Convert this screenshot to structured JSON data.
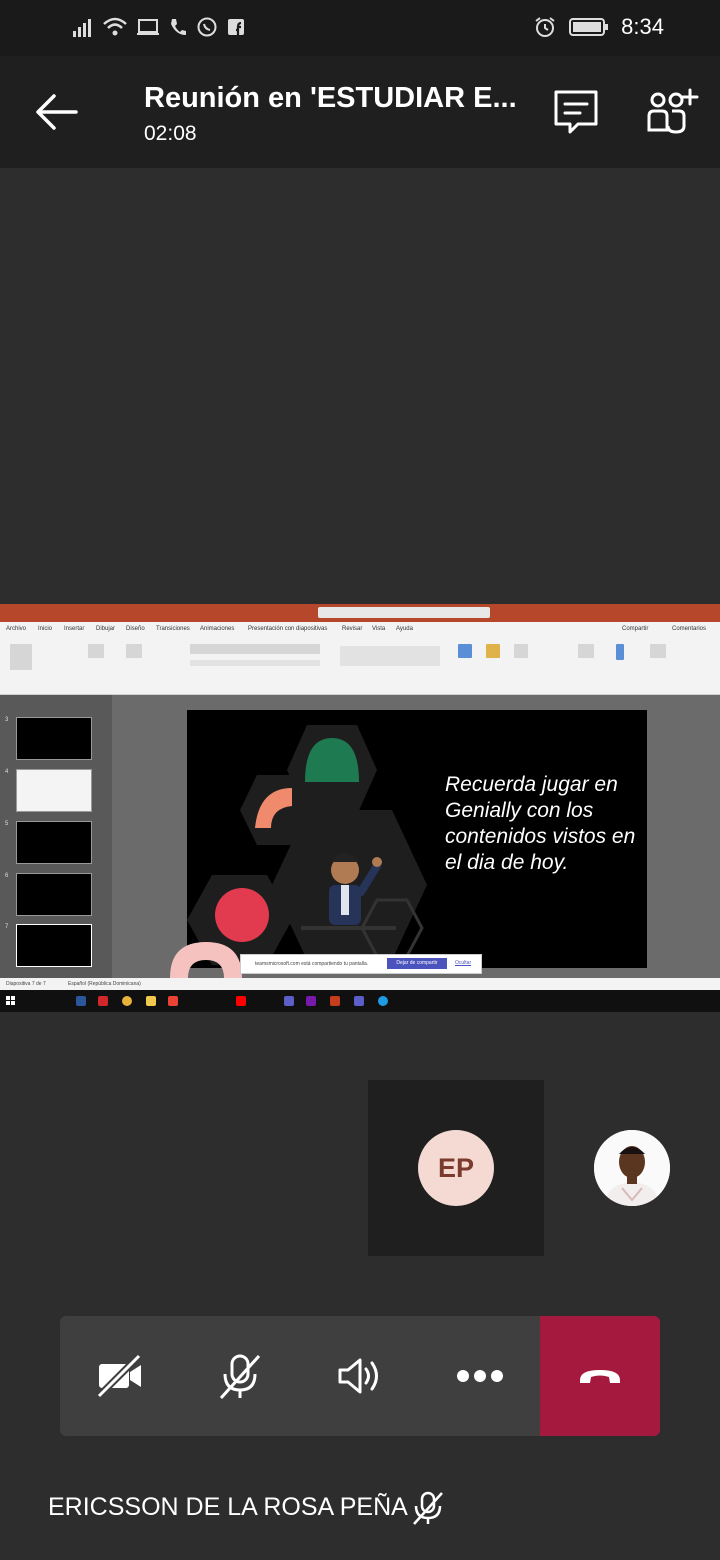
{
  "status_bar": {
    "time": "8:34"
  },
  "header": {
    "title": "Reunión en 'ESTUDIAR E...",
    "duration": "02:08"
  },
  "shared_screen": {
    "ppt_tabs": [
      "Archivo",
      "Inicio",
      "Insertar",
      "Dibujar",
      "Diseño",
      "Transiciones",
      "Animaciones",
      "Presentación con diapositivas",
      "Revisar",
      "Vista",
      "Ayuda"
    ],
    "share_button": "Compartir",
    "comments_button": "Comentarios",
    "slide_numbers": [
      "3",
      "4",
      "5",
      "6",
      "7"
    ],
    "slide_text": "Recuerda jugar en Genially con los contenidos vistos en el dia de hoy.",
    "sharing_banner": {
      "message": "teamsmicrosoft.com está compartiendo tu pantalla.",
      "stop_label": "Dejar de compartir",
      "hide_label": "Ocultar"
    },
    "status_left": "Diapositiva 7 de 7",
    "status_lang": "Español (República Dominicana)"
  },
  "participants": {
    "ep_initials": "EP"
  },
  "self_name": "ERICSSON DE LA ROSA PEÑA",
  "colors": {
    "background": "#2d2d2d",
    "hangup": "#a4193d",
    "avatar_bg": "#f5d9d3",
    "avatar_text": "#7a3a2e",
    "controls_bg": "#3f3f3f"
  }
}
